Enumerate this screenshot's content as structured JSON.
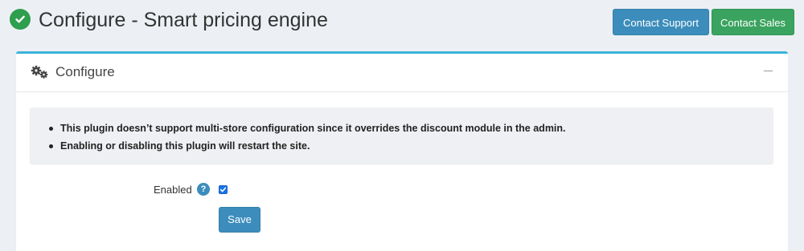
{
  "header": {
    "title": "Configure - Smart pricing engine",
    "status_icon": "check-circle-icon",
    "contact_support_label": "Contact Support",
    "contact_sales_label": "Contact Sales"
  },
  "card": {
    "title": "Configure",
    "title_icon": "gears-icon",
    "collapse_icon": "minus-icon",
    "accent_color": "#3bb4d8"
  },
  "info": {
    "items": [
      "This plugin doesn’t support multi-store configuration since it overrides the discount module in the admin.",
      "Enabling or disabling this plugin will restart the site."
    ]
  },
  "form": {
    "enabled_label": "Enabled",
    "help_icon_text": "?",
    "enabled_checked": true,
    "save_label": "Save"
  },
  "colors": {
    "primary": "#3c8dbc",
    "success": "#3aa35f",
    "status_green": "#2e9e4f",
    "background": "#ecf0f5"
  }
}
